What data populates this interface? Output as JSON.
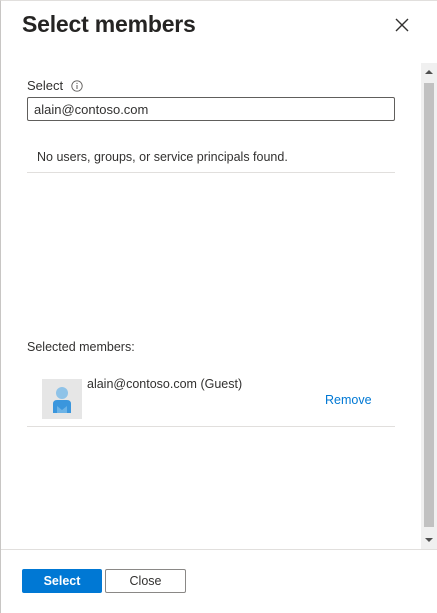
{
  "panel": {
    "title": "Select members"
  },
  "search": {
    "label": "Select",
    "value": "alain@contoso.com"
  },
  "results": {
    "empty_message": "No users, groups, or service principals found."
  },
  "selected": {
    "label": "Selected members:",
    "members": [
      {
        "name": "alain@contoso.com (Guest)",
        "remove_label": "Remove"
      }
    ]
  },
  "footer": {
    "select_label": "Select",
    "close_label": "Close"
  },
  "colors": {
    "accent": "#0078d4",
    "link": "#0078d4"
  }
}
